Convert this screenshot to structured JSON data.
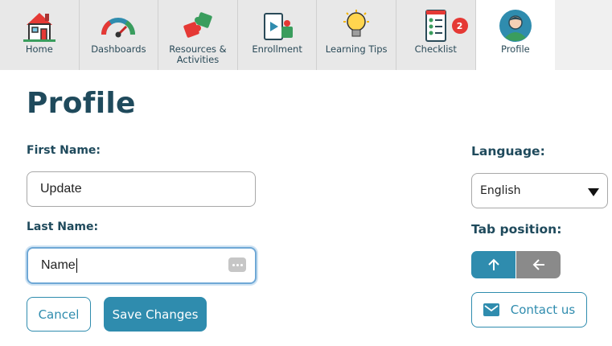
{
  "tabs": [
    {
      "label": "Home",
      "icon": "home-icon"
    },
    {
      "label": "Dashboards",
      "icon": "gauge-icon"
    },
    {
      "label": "Resources &\nActivities",
      "icon": "puzzle-icon"
    },
    {
      "label": "Enrollment",
      "icon": "devices-icon"
    },
    {
      "label": "Learning Tips",
      "icon": "lightbulb-icon"
    },
    {
      "label": "Checklist",
      "icon": "checklist-icon",
      "badge": "2"
    },
    {
      "label": "Profile",
      "icon": "profile-avatar-icon",
      "active": true
    }
  ],
  "page": {
    "title": "Profile"
  },
  "form": {
    "first_name_label": "First Name:",
    "first_name_value": "Update",
    "last_name_label": "Last Name:",
    "last_name_value": "Name",
    "cancel_label": "Cancel",
    "save_label": "Save Changes"
  },
  "settings": {
    "language_label": "Language:",
    "language_value": "English",
    "tab_position_label": "Tab position:",
    "tab_position_options": [
      "up-arrow-icon",
      "left-arrow-icon"
    ],
    "tab_position_selected": "up-arrow-icon",
    "contact_label": "Contact us",
    "contact_icon": "mail-icon"
  },
  "colors": {
    "accent": "#2f8cae",
    "title": "#1f4a5c",
    "badge": "#e53935"
  }
}
